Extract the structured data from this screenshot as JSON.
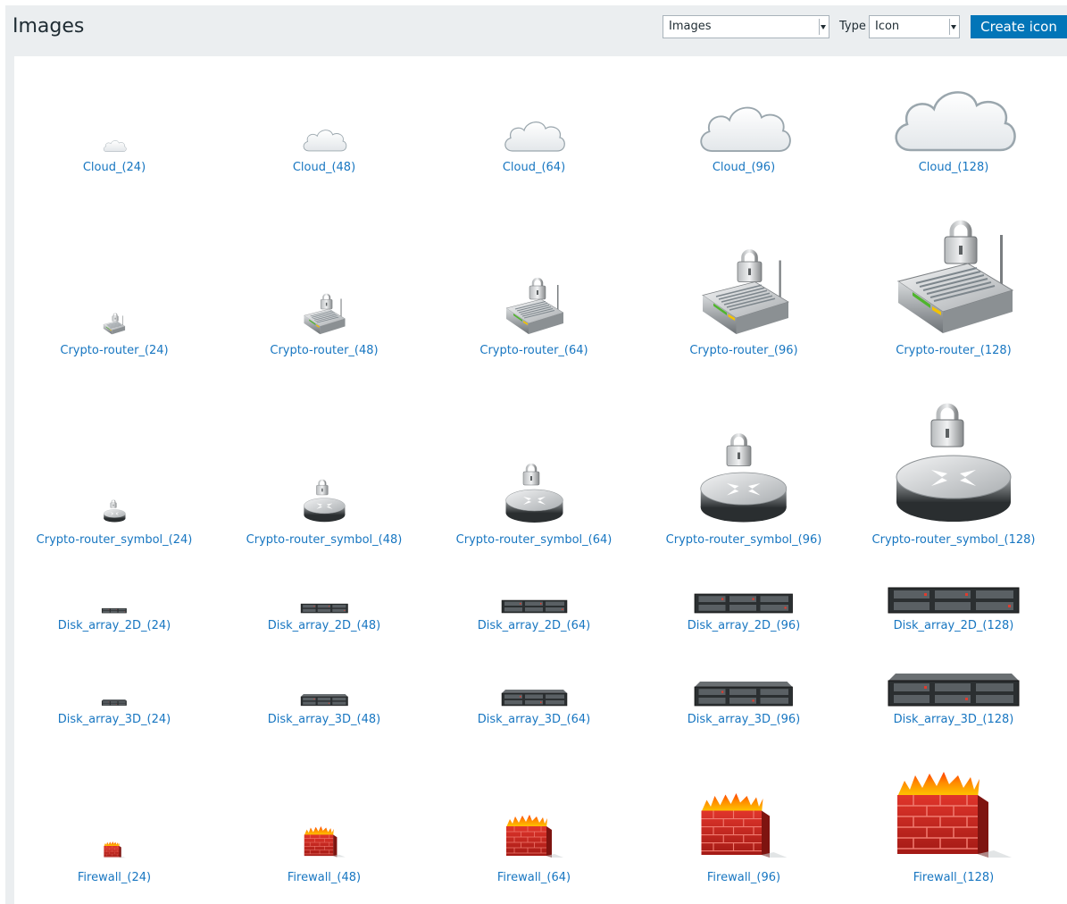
{
  "header": {
    "title": "Images",
    "image_select": "Images",
    "type_label": "Type",
    "type_select": "Icon",
    "create_button": "Create icon"
  },
  "colors": {
    "accent": "#0275b8",
    "link": "#1776c1",
    "header_bg": "#ebeef0"
  },
  "rows": [
    {
      "kind": "cloud",
      "icon_name": "cloud-icon",
      "labels": [
        "Cloud_(24)",
        "Cloud_(48)",
        "Cloud_(64)",
        "Cloud_(96)",
        "Cloud_(128)"
      ]
    },
    {
      "kind": "router",
      "icon_name": "crypto-router-icon",
      "labels": [
        "Crypto-router_(24)",
        "Crypto-router_(48)",
        "Crypto-router_(64)",
        "Crypto-router_(96)",
        "Crypto-router_(128)"
      ]
    },
    {
      "kind": "symbol",
      "icon_name": "crypto-router-symbol-icon",
      "labels": [
        "Crypto-router_symbol_(24)",
        "Crypto-router_symbol_(48)",
        "Crypto-router_symbol_(64)",
        "Crypto-router_symbol_(96)",
        "Crypto-router_symbol_(128)"
      ]
    },
    {
      "kind": "disk2d",
      "icon_name": "disk-array-2d-icon",
      "labels": [
        "Disk_array_2D_(24)",
        "Disk_array_2D_(48)",
        "Disk_array_2D_(64)",
        "Disk_array_2D_(96)",
        "Disk_array_2D_(128)"
      ]
    },
    {
      "kind": "disk3d",
      "icon_name": "disk-array-3d-icon",
      "labels": [
        "Disk_array_3D_(24)",
        "Disk_array_3D_(48)",
        "Disk_array_3D_(64)",
        "Disk_array_3D_(96)",
        "Disk_array_3D_(128)"
      ]
    },
    {
      "kind": "firewall",
      "icon_name": "firewall-icon",
      "labels": [
        "Firewall_(24)",
        "Firewall_(48)",
        "Firewall_(64)",
        "Firewall_(96)",
        "Firewall_(128)"
      ]
    }
  ]
}
